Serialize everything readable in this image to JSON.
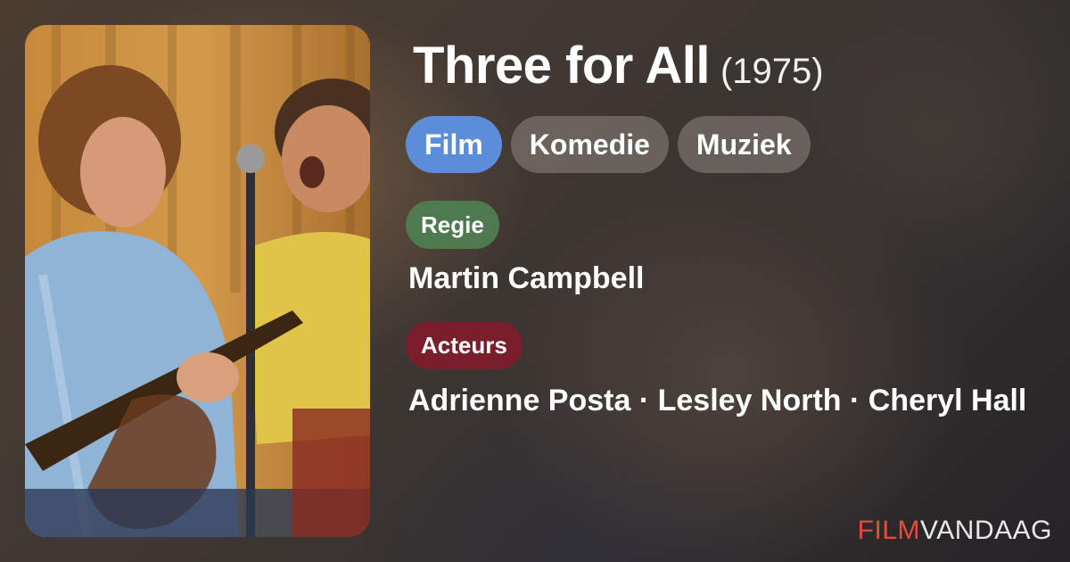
{
  "movie": {
    "title": "Three for All",
    "year": "(1975)",
    "poster_alt": "movie-still"
  },
  "tags": [
    {
      "label": "Film",
      "color": "#5b8dd8"
    },
    {
      "label": "Komedie"
    },
    {
      "label": "Muziek"
    }
  ],
  "credits": {
    "director_label": "Regie",
    "director": "Martin Campbell",
    "actors_label": "Acteurs",
    "actors": "Adrienne Posta · Lesley North · Cheryl Hall"
  },
  "brand": {
    "part1": "FILM",
    "part2": "VANDAAG",
    "accent": "#e64b3c"
  },
  "colors": {
    "regie_pill": "#4f7a4f",
    "acteurs_pill": "#7a1e2c"
  }
}
